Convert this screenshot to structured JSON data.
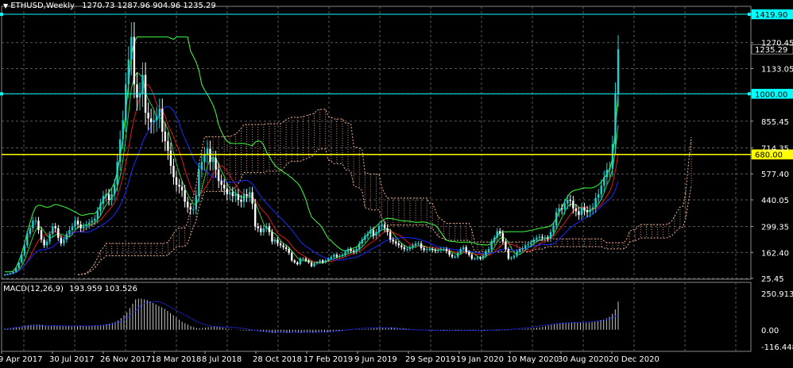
{
  "header": {
    "symbol": "ETHUSD,Weekly",
    "ohlc": "1270.73 1287.96 904.96 1235.29",
    "icon": "triangle-down-icon"
  },
  "macd": {
    "label": "MACD(12,26,9)",
    "values": "193.959 103.526"
  },
  "colors": {
    "background": "#000000",
    "grid": "#5a5a5a",
    "candle_up": "#20d0d0",
    "candle_down": "#ffffff",
    "hline_cyan": "#00ffff",
    "hline_yellow": "#ffff00",
    "line_green": "#2dd12d",
    "line_red": "#e01818",
    "line_blue": "#1a2bff",
    "line_bright_green": "#40ff40",
    "cloud": "#f0b090"
  },
  "chart_data": [
    {
      "type": "candlestick",
      "title": "ETHUSD,Weekly",
      "grid": true,
      "price_axis": {
        "tick_labels": [
          "1419.90",
          "1270.45",
          "1133.05",
          "1000.00",
          "855.45",
          "714.35",
          "680.00",
          "577.40",
          "440.05",
          "299.35",
          "162.40",
          "25.45"
        ],
        "ticks": [
          1419.9,
          1270.45,
          1133.05,
          1000.0,
          855.45,
          714.35,
          680.0,
          577.4,
          440.05,
          299.35,
          162.4,
          25.45
        ],
        "ylim": [
          25.45,
          1419.9
        ]
      },
      "time_axis": {
        "tick_labels": [
          "9 Apr 2017",
          "30 Jul 2017",
          "26 Nov 2017",
          "18 Mar 2018",
          "8 Jul 2018",
          "28 Oct 2018",
          "17 Feb 2019",
          "9 Jun 2019",
          "29 Sep 2019",
          "19 Jan 2020",
          "10 May 2020",
          "30 Aug 2020",
          "20 Dec 2020"
        ]
      },
      "last_price": 1235.29,
      "horizontal_levels": [
        {
          "price": 1419.9,
          "color": "cyan",
          "label": "1419.90"
        },
        {
          "price": 1000.0,
          "color": "cyan",
          "label": "1000.00"
        },
        {
          "price": 680.0,
          "color": "yellow",
          "label": "680.00"
        },
        {
          "price": 1235.29,
          "color": "white",
          "label": "1235.29"
        }
      ],
      "closes": [
        45,
        48,
        52,
        60,
        80,
        110,
        150,
        200,
        260,
        290,
        330,
        330,
        280,
        230,
        200,
        220,
        260,
        300,
        290,
        240,
        210,
        230,
        260,
        280,
        300,
        330,
        310,
        290,
        300,
        310,
        320,
        330,
        340,
        380,
        420,
        460,
        470,
        440,
        470,
        520,
        640,
        760,
        860,
        1050,
        1180,
        1300,
        1050,
        980,
        1000,
        1100,
        900,
        870,
        850,
        860,
        880,
        920,
        800,
        750,
        700,
        620,
        560,
        520,
        510,
        490,
        430,
        400,
        390,
        390,
        460,
        600,
        640,
        680,
        710,
        640,
        660,
        600,
        540,
        520,
        500,
        470,
        480,
        460,
        470,
        440,
        430,
        470,
        460,
        480,
        420,
        300,
        290,
        270,
        290,
        300,
        270,
        220,
        230,
        210,
        200,
        190,
        180,
        160,
        120,
        110,
        100,
        130,
        130,
        120,
        110,
        90,
        105,
        110,
        120,
        110,
        120,
        130,
        140,
        150,
        140,
        145,
        150,
        165,
        180,
        170,
        165,
        180,
        210,
        230,
        250,
        260,
        280,
        250,
        270,
        300,
        310,
        290,
        270,
        230,
        220,
        210,
        200,
        190,
        180,
        180,
        190,
        200,
        210,
        210,
        185,
        175,
        180,
        180,
        175,
        170,
        175,
        180,
        180,
        170,
        150,
        140,
        140,
        160,
        180,
        190,
        165,
        150,
        130,
        130,
        135,
        130,
        145,
        170,
        180,
        220,
        240,
        275,
        265,
        220,
        180,
        130,
        135,
        145,
        165,
        180,
        185,
        200,
        205,
        215,
        230,
        240,
        245,
        240,
        240,
        235,
        270,
        305,
        375,
        395,
        390,
        420,
        440,
        435,
        395,
        380,
        360,
        400,
        385,
        375,
        390,
        400,
        450,
        470,
        515,
        560,
        600,
        605,
        735,
        1000,
        1235.29
      ]
    },
    {
      "type": "bar",
      "title": "MACD(12,26,9)",
      "values_shown": [
        193.959,
        103.526
      ],
      "axis": {
        "tick_labels": [
          "250.913",
          "0.00",
          "-116.448"
        ],
        "ylim": [
          -116.448,
          250.913
        ]
      },
      "histogram": [
        8,
        10,
        12,
        14,
        16,
        20,
        25,
        28,
        30,
        33,
        35,
        36,
        35,
        33,
        30,
        28,
        28,
        28,
        27,
        26,
        25,
        25,
        25,
        25,
        26,
        27,
        27,
        26,
        26,
        26,
        26,
        27,
        28,
        30,
        33,
        37,
        42,
        48,
        55,
        65,
        80,
        100,
        120,
        150,
        180,
        210,
        215,
        215,
        210,
        205,
        195,
        185,
        175,
        165,
        155,
        145,
        130,
        115,
        100,
        85,
        70,
        55,
        45,
        35,
        25,
        18,
        12,
        10,
        12,
        15,
        18,
        20,
        22,
        20,
        18,
        14,
        10,
        6,
        3,
        0,
        -2,
        -4,
        -5,
        -6,
        -7,
        -7,
        -7,
        -8,
        -10,
        -14,
        -18,
        -20,
        -22,
        -22,
        -21,
        -21,
        -21,
        -21,
        -21,
        -20,
        -20,
        -20,
        -20,
        -20,
        -20,
        -20,
        -20,
        -19,
        -19,
        -19,
        -18,
        -17,
        -16,
        -14,
        -12,
        -10,
        -8,
        -6,
        -4,
        -2,
        0,
        2,
        3,
        4,
        5,
        6,
        8,
        10,
        12,
        14,
        15,
        16,
        16,
        16,
        15,
        14,
        12,
        10,
        8,
        6,
        4,
        2,
        0,
        -1,
        -2,
        -3,
        -4,
        -5,
        -5,
        -6,
        -6,
        -6,
        -6,
        -6,
        -6,
        -6,
        -6,
        -6,
        -6,
        -6,
        -5,
        -5,
        -5,
        -5,
        -5,
        -5,
        -5,
        -5,
        -5,
        -5,
        -5,
        -4,
        -4,
        -3,
        -2,
        -1,
        0,
        2,
        4,
        6,
        8,
        10,
        12,
        14,
        16,
        20,
        25,
        30,
        34,
        38,
        41,
        44,
        47,
        49,
        50,
        50,
        50,
        49,
        49,
        49,
        48,
        50,
        52,
        56,
        60,
        65,
        70,
        80,
        90,
        110,
        140,
        193.959
      ],
      "signal": [
        5,
        8,
        12,
        15,
        18,
        22,
        25,
        26,
        27,
        28,
        28,
        27,
        27,
        27,
        27,
        27,
        26,
        26,
        26,
        26,
        26,
        27,
        28,
        29,
        30,
        32,
        35,
        40,
        45,
        55,
        70,
        90,
        110,
        135,
        160,
        180,
        190,
        195,
        195,
        190,
        180,
        165,
        150,
        135,
        120,
        105,
        90,
        75,
        60,
        48,
        38,
        30,
        25,
        22,
        20,
        18,
        17,
        16,
        15,
        12,
        8,
        4,
        0,
        -4,
        -8,
        -11,
        -13,
        -15,
        -16,
        -17,
        -18,
        -18,
        -18,
        -18,
        -18,
        -18,
        -18,
        -17,
        -17,
        -17,
        -16,
        -15,
        -13,
        -10,
        -7,
        -4,
        -1,
        2,
        5,
        8,
        10,
        12,
        13,
        14,
        14,
        14,
        13,
        11,
        9,
        7,
        5,
        3,
        1,
        0,
        -1,
        -2,
        -3,
        -4,
        -4,
        -5,
        -5,
        -5,
        -5,
        -5,
        -5,
        -5,
        -5,
        -5,
        -5,
        -5,
        -4,
        -4,
        -3,
        -2,
        -1,
        0,
        1,
        3,
        5,
        7,
        10,
        13,
        17,
        21,
        25,
        29,
        33,
        37,
        40,
        43,
        45,
        47,
        49,
        50,
        51,
        52,
        53,
        55,
        57,
        60,
        64,
        70,
        78,
        88,
        103.526
      ]
    }
  ]
}
